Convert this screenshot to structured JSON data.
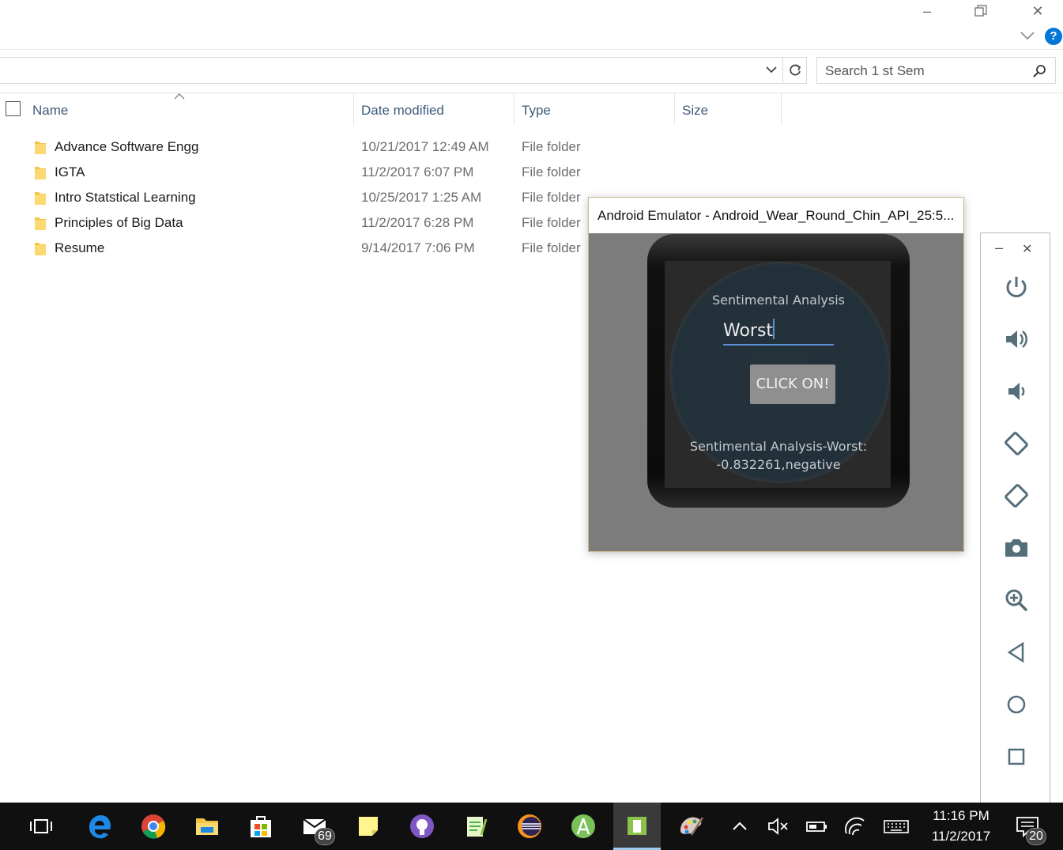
{
  "explorer": {
    "search_placeholder": "Search 1 st Sem",
    "columns": {
      "name": "Name",
      "date": "Date modified",
      "type": "Type",
      "size": "Size"
    },
    "rows": [
      {
        "name": "Advance Software Engg",
        "date": "10/21/2017 12:49 AM",
        "type": "File folder"
      },
      {
        "name": "IGTA",
        "date": "11/2/2017 6:07 PM",
        "type": "File folder"
      },
      {
        "name": "Intro Statstical Learning",
        "date": "10/25/2017 1:25 AM",
        "type": "File folder"
      },
      {
        "name": "Principles of Big Data",
        "date": "11/2/2017 6:28 PM",
        "type": "File folder"
      },
      {
        "name": "Resume",
        "date": "9/14/2017 7:06 PM",
        "type": "File folder"
      }
    ]
  },
  "emulator": {
    "title": "Android Emulator - Android_Wear_Round_Chin_API_25:5...",
    "app_title": "Sentimental Analysis",
    "input_value": "Worst",
    "button_label": "CLICK ON!",
    "result_line1": "Sentimental Analysis-Worst:",
    "result_line2": "-0.832261,negative"
  },
  "side_toolbar": {
    "minimize": "–",
    "close": "✕",
    "icons": [
      "power-icon",
      "volume-up-icon",
      "volume-down-icon",
      "rotate-left-icon",
      "rotate-right-icon",
      "camera-icon",
      "zoom-icon",
      "back-icon",
      "home-icon",
      "overview-icon"
    ]
  },
  "taskbar": {
    "mail_badge": "69",
    "notification_badge": "20",
    "time": "11:16 PM",
    "date": "11/2/2017"
  },
  "colors": {
    "accent": "#0078d7",
    "header_text": "#3c5a7a",
    "taskbar": "#101010",
    "input_underline": "#5b8fd0"
  }
}
